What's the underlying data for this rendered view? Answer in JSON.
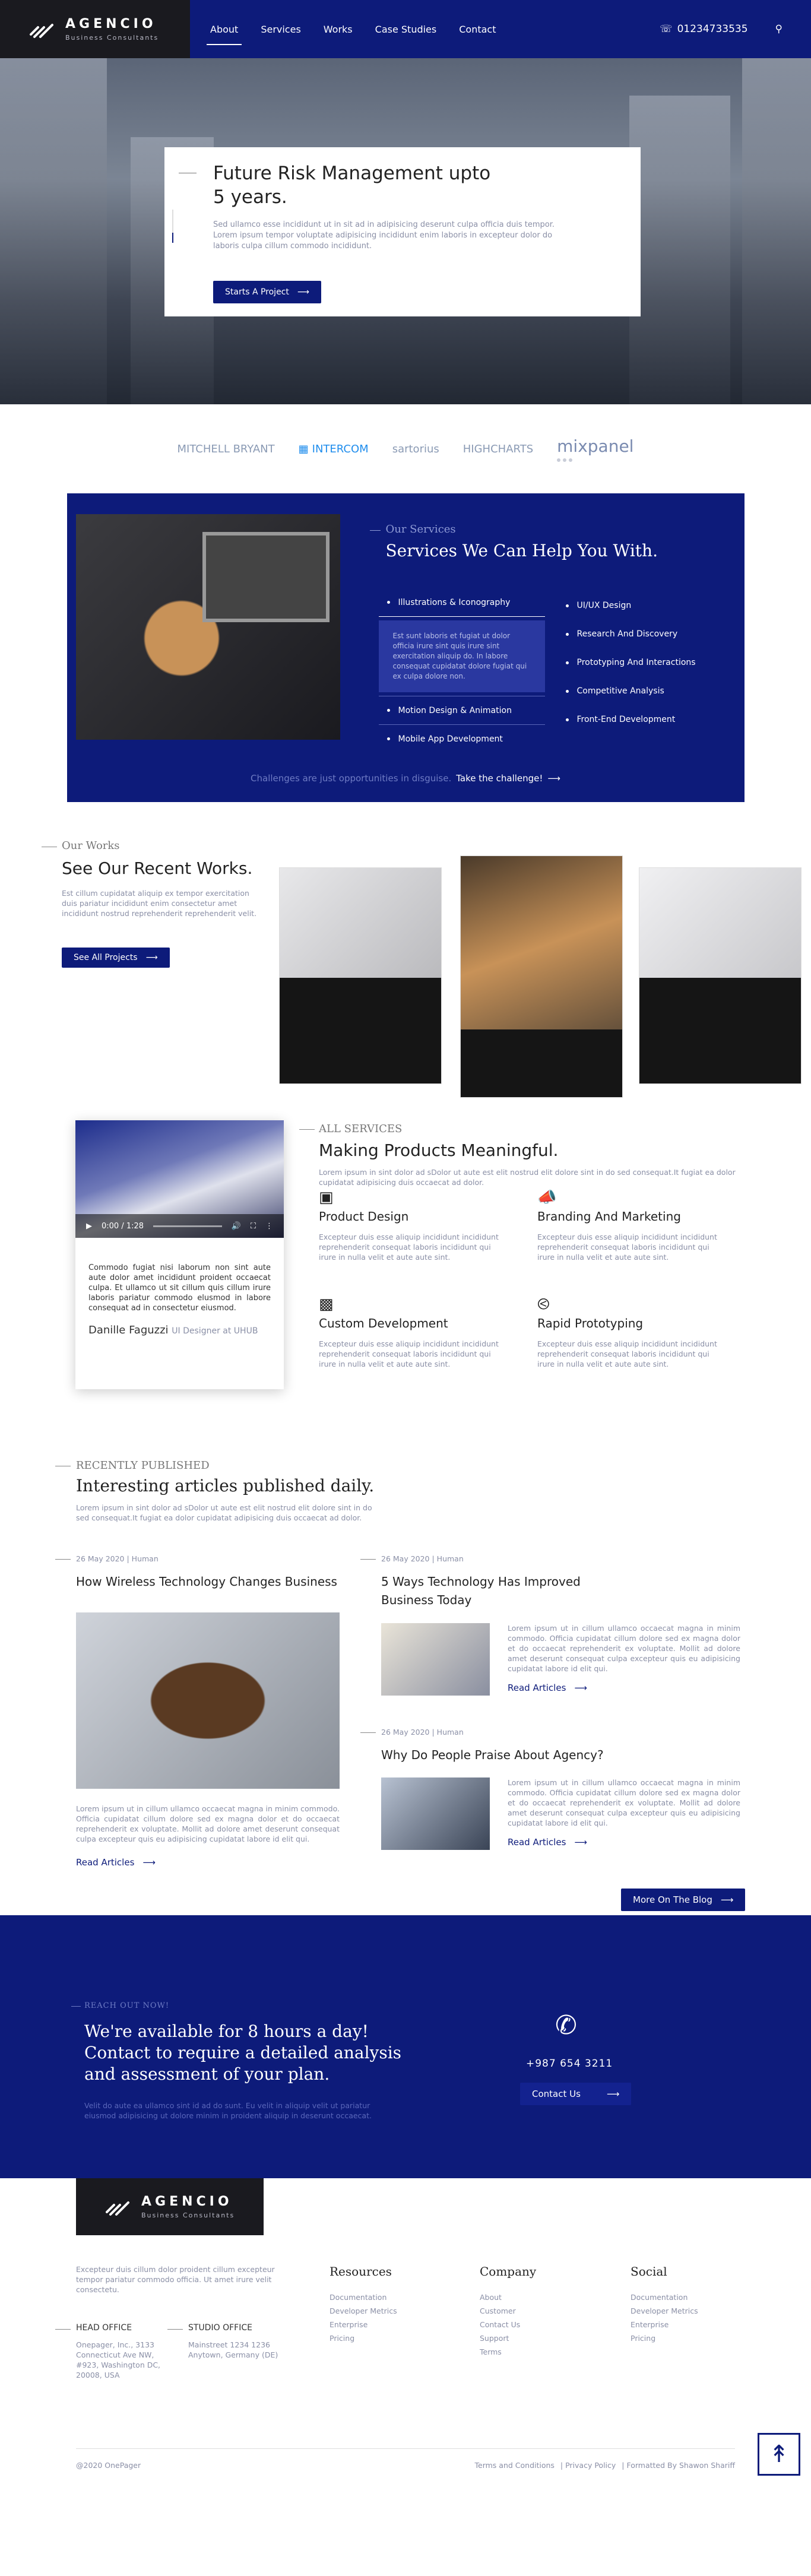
{
  "header": {
    "brand_name": "AGENCIO",
    "brand_sub": "Business Consultants",
    "nav": [
      "About",
      "Services",
      "Works",
      "Case Studies",
      "Contact"
    ],
    "phone": "01234733535",
    "accent": "#0d1b7a"
  },
  "hero": {
    "title": "Future Risk Management upto 5 years.",
    "text": "Sed ullamco esse incididunt ut in sit ad in adipisicing deserunt culpa officia duis tempor. Lorem ipsum tempor voluptate adipisicing incididunt enim laboris in excepteur dolor do laboris culpa cillum commodo incididunt.",
    "button": "Starts A Project"
  },
  "clients": [
    "MITCHELL BRYANT",
    "INTERCOM",
    "sartorius",
    "HIGHCHARTS",
    "mixpanel"
  ],
  "services": {
    "label": "Our Services",
    "title": "Services We Can Help You With.",
    "col1": [
      "Illustrations & Iconography",
      "Motion Design & Animation",
      "Mobile App Development"
    ],
    "col1_desc": "Est sunt laboris et fugiat ut dolor officia irure sint quis irure sint exercitation aliquip do. In labore consequat cupidatat dolore fugiat qui ex culpa dolore non.",
    "col2": [
      "UI/UX Design",
      "Research And Discovery",
      "Prototyping And Interactions",
      "Competitive Analysis",
      "Front-End Development"
    ],
    "footer_text": "Challenges are just opportunities in disguise.",
    "footer_link": "Take the challenge!"
  },
  "works": {
    "label": "Our Works",
    "title": "See Our Recent Works.",
    "text": "Est cillum cupidatat aliquip ex tempor exercitation duis pariatur incididunt enim consectetur amet incididunt nostrud reprehenderit reprehenderit velit.",
    "button": "See All Projects"
  },
  "all_services": {
    "video_time": "0:00 / 1:28",
    "quote": "Commodo fugiat nisi laborum non sint aute aute dolor amet incididunt proident occaecat culpa. Et ullamco ut sit cillum quis cillum irure laboris pariatur commodo elusmod in labore consequat ad in consectetur eiusmod.",
    "author_name": "Danille Faguzzi",
    "author_role": "UI Designer at UHUB",
    "label": "ALL SERVICES",
    "title": "Making Products Meaningful.",
    "text": "Lorem ipsum in sint dolor ad sDolor ut aute est elit nostrud elit dolore sint in do sed consequat.It fugiat ea dolor cupidatat adipisicing duis occaecat ad dolor.",
    "features": [
      {
        "title": "Product Design",
        "text": "Excepteur duis esse aliquip incididunt incididunt reprehenderit consequat laboris incididunt qui irure in nulla velit et aute aute sint."
      },
      {
        "title": "Branding And Marketing",
        "text": "Excepteur duis esse aliquip incididunt incididunt reprehenderit consequat laboris incididunt qui irure in nulla velit et aute aute sint."
      },
      {
        "title": "Custom Development",
        "text": "Excepteur duis esse aliquip incididunt incididunt reprehenderit consequat laboris incididunt qui irure in nulla velit et aute aute sint."
      },
      {
        "title": "Rapid Prototyping",
        "text": "Excepteur duis esse aliquip incididunt incididunt reprehenderit consequat laboris incididunt qui irure in nulla velit et aute aute sint."
      }
    ]
  },
  "blog": {
    "label": "RECENTLY PUBLISHED",
    "title": "Interesting articles published daily.",
    "text": "Lorem ipsum in sint dolor ad sDolor ut aute est elit nostrud elit dolore sint in do sed consequat.It fugiat ea dolor cupidatat adipisicing duis occaecat ad dolor.",
    "posts": [
      {
        "meta": "26 May 2020 | Human",
        "title": "How Wireless Technology Changes Business",
        "text": "Lorem ipsum ut in cillum ullamco occaecat magna in minim commodo. Officia cupidatat cillum dolore sed ex magna dolor et do occaecat reprehenderit ex voluptate. Mollit ad dolore amet deserunt consequat culpa excepteur quis eu adipisicing cupidatat labore id elit qui.",
        "read": "Read Articles"
      },
      {
        "meta": "26 May 2020 | Human",
        "title": "5 Ways Technology Has Improved Business Today",
        "text": "Lorem ipsum ut in cillum ullamco occaecat magna in minim commodo. Officia cupidatat cillum dolore sed ex magna dolor et do occaecat reprehenderit ex voluptate. Mollit ad dolore amet deserunt consequat culpa excepteur quis eu adipisicing cupidatat labore id elit qui.",
        "read": "Read Articles"
      },
      {
        "meta": "26 May 2020 | Human",
        "title": "Why Do People Praise About Agency?",
        "text": "Lorem ipsum ut in cillum ullamco occaecat magna in minim commodo. Officia cupidatat cillum dolore sed ex magna dolor et do occaecat reprehenderit ex voluptate. Mollit ad dolore amet deserunt consequat culpa excepteur quis eu adipisicing cupidatat labore id elit qui.",
        "read": "Read Articles"
      }
    ],
    "more_button": "More On The Blog"
  },
  "cta": {
    "label": "REACH OUT NOW!",
    "title": "We're available for 8 hours a day! Contact to require a detailed analysis and assessment of your plan.",
    "text": "Velit do aute ea ullamco sint id ad do sunt. Eu velit in aliquip velit ut pariatur eiusmod adipisicing ut dolore minim in proident aliquip in deserunt occaecat.",
    "phone": "+987 654 3211",
    "button": "Contact Us"
  },
  "footer": {
    "brand_name": "AGENCIO",
    "brand_sub": "Business Consultants",
    "text": "Excepteur duis cillum dolor proident cillum excepteur tempor pariatur commodo officia. Ut amet irure velit consectetu.",
    "head_office": {
      "title": "HEAD OFFICE",
      "address": "Onepager, Inc., 3133 Connecticut Ave NW, #923, Washington DC, 20008, USA"
    },
    "studio_office": {
      "title": "STUDIO OFFICE",
      "address": "Mainstreet 1234 1236 Anytown, Germany (DE)"
    },
    "columns": [
      {
        "title": "Resources",
        "links": [
          "Documentation",
          "Developer Metrics",
          "Enterprise",
          "Pricing"
        ]
      },
      {
        "title": "Company",
        "links": [
          "About",
          "Customer",
          "Contact Us",
          "Support",
          "Terms"
        ]
      },
      {
        "title": "Social",
        "links": [
          "Documentation",
          "Developer Metrics",
          "Enterprise",
          "Pricing"
        ]
      }
    ],
    "copyright": "@2020 OnePager",
    "bottom_links": [
      "Terms and Conditions",
      "Privacy Policy",
      "Formatted By Shawon Shariff"
    ]
  }
}
